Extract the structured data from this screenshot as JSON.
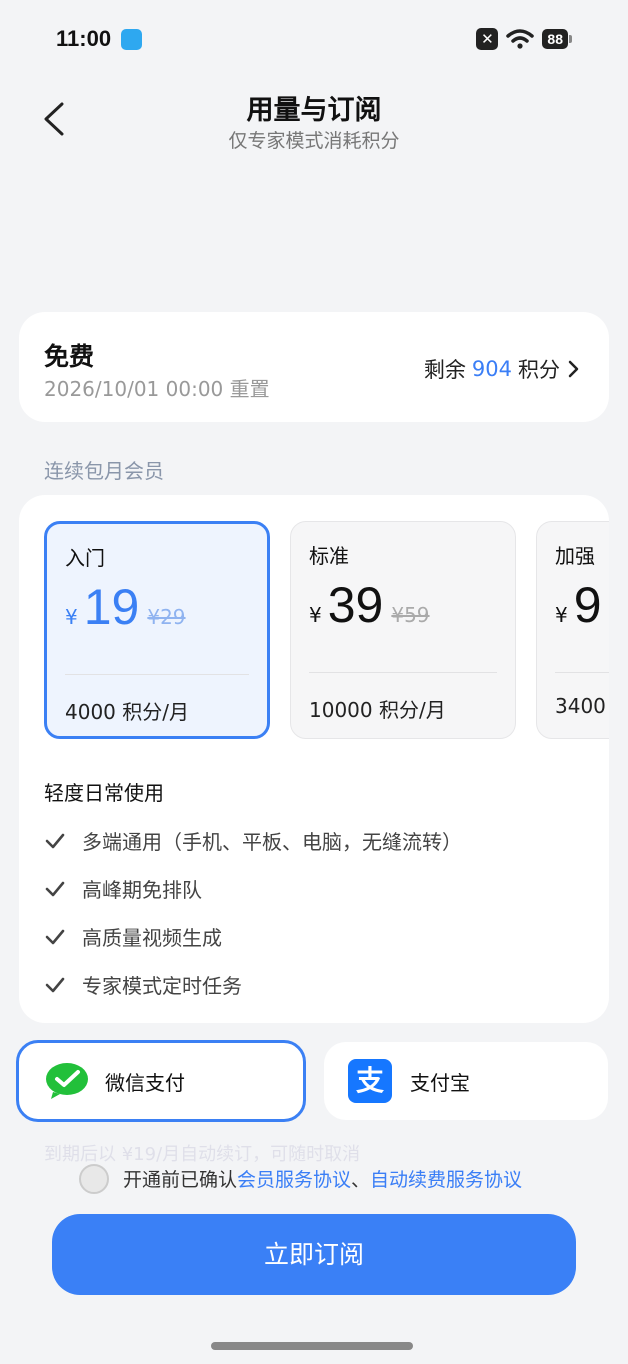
{
  "status_bar": {
    "time": "11:00",
    "battery": "88"
  },
  "header": {
    "title": "用量与订阅",
    "subtitle": "仅专家模式消耗积分"
  },
  "free_plan": {
    "name": "免费",
    "reset": "2026/10/01 00:00 重置",
    "remain_prefix": "剩余",
    "remain_value": "904",
    "remain_suffix": "积分"
  },
  "section_label": "连续包月会员",
  "plans": [
    {
      "name": "入门",
      "currency": "¥",
      "price": "19",
      "original": "¥29",
      "credits": "4000 积分/月",
      "selected": true
    },
    {
      "name": "标准",
      "currency": "¥",
      "price": "39",
      "original": "¥59",
      "credits": "10000 积分/月",
      "selected": false
    },
    {
      "name": "加强",
      "currency": "¥",
      "price": "9",
      "original": "",
      "credits": "3400",
      "selected": false
    }
  ],
  "features": {
    "heading": "轻度日常使用",
    "items": [
      "多端通用（手机、平板、电脑，无缝流转）",
      "高峰期免排队",
      "高质量视频生成",
      "专家模式定时任务"
    ]
  },
  "payment": {
    "wechat": "微信支付",
    "alipay": "支付宝",
    "alipay_glyph": "支"
  },
  "faded_note": "到期后以 ¥19/月自动续订，可随时取消",
  "agreement": {
    "prefix": "开通前已确认",
    "link1": "会员服务协议",
    "sep": "、",
    "link2": "自动续费服务协议"
  },
  "cta": "立即订阅",
  "colors": {
    "accent": "#3a80f6",
    "wechat": "#22c03a",
    "alipay": "#1677ff"
  }
}
